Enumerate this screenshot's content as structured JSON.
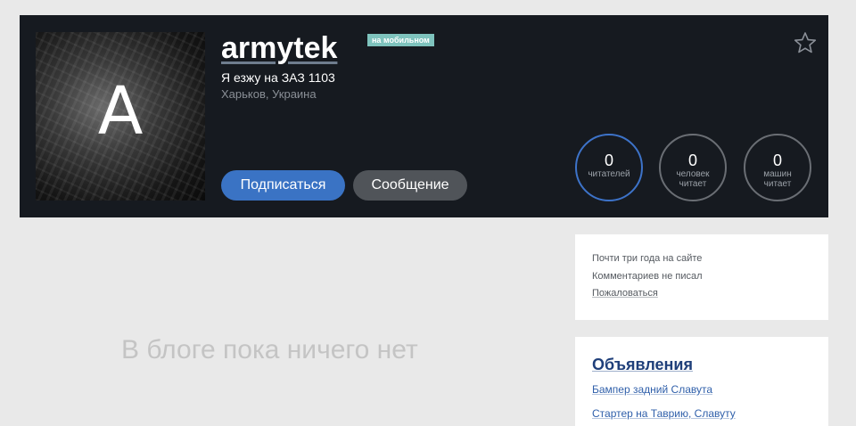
{
  "profile": {
    "avatar_letter": "A",
    "username": "armytek",
    "mobile_badge": "на мобильном",
    "car_line": "Я езжу на ЗАЗ 1103",
    "location": "Харьков, Украина",
    "subscribe_label": "Подписаться",
    "message_label": "Сообщение",
    "stats": [
      {
        "value": "0",
        "label": "читателей"
      },
      {
        "value": "0",
        "label": "человек читает"
      },
      {
        "value": "0",
        "label": "машин читает"
      }
    ]
  },
  "blog": {
    "empty_text": "В блоге пока ничего нет"
  },
  "info": {
    "line1": "Почти три года на сайте",
    "line2": "Комментариев не писал",
    "report_link": "Пожаловаться"
  },
  "ads": {
    "title": "Объявления",
    "items": [
      {
        "label": "Бампер задний Славута"
      },
      {
        "label": "Стартер на Таврию, Славуту"
      }
    ]
  },
  "colors": {
    "header_bg": "#161a20",
    "accent_blue": "#3a73c4",
    "badge_teal": "#7ec3bd"
  }
}
